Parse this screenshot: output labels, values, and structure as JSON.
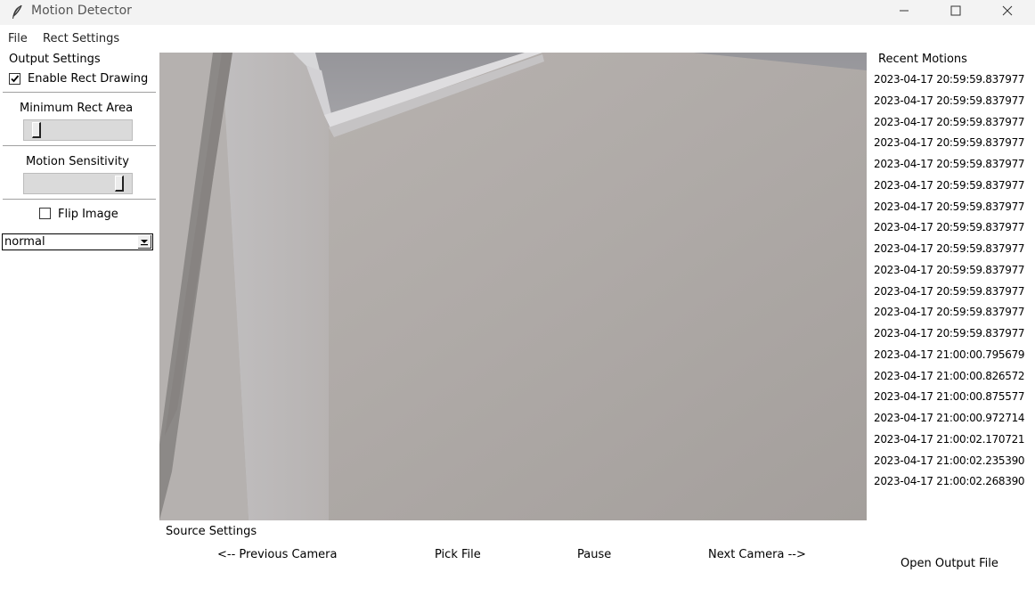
{
  "window": {
    "title": "Motion Detector",
    "app_icon": "feather-icon",
    "controls": [
      "minimize-icon",
      "maximize-icon",
      "close-icon"
    ]
  },
  "menu": {
    "file": "File",
    "rect_settings": "Rect Settings"
  },
  "output_settings": {
    "title": "Output Settings",
    "enable_rect_drawing": {
      "label": "Enable Rect Drawing",
      "checked": true
    },
    "minimum_rect_area": {
      "label": "Minimum Rect Area",
      "level": 0.08
    },
    "motion_sensitivity": {
      "label": "Motion Sensitivity",
      "level": 0.92
    },
    "flip_image": {
      "label": "Flip Image",
      "checked": false
    },
    "mode": {
      "value": "normal"
    }
  },
  "recent_motions": {
    "title": "Recent Motions",
    "items": [
      "2023-04-17 20:59:59.837977",
      "2023-04-17 20:59:59.837977",
      "2023-04-17 20:59:59.837977",
      "2023-04-17 20:59:59.837977",
      "2023-04-17 20:59:59.837977",
      "2023-04-17 20:59:59.837977",
      "2023-04-17 20:59:59.837977",
      "2023-04-17 20:59:59.837977",
      "2023-04-17 20:59:59.837977",
      "2023-04-17 20:59:59.837977",
      "2023-04-17 20:59:59.837977",
      "2023-04-17 20:59:59.837977",
      "2023-04-17 20:59:59.837977",
      "2023-04-17 21:00:00.795679",
      "2023-04-17 21:00:00.826572",
      "2023-04-17 21:00:00.875577",
      "2023-04-17 21:00:00.972714",
      "2023-04-17 21:00:02.170721",
      "2023-04-17 21:00:02.235390",
      "2023-04-17 21:00:02.268390"
    ]
  },
  "source_settings": {
    "title": "Source Settings",
    "previous_camera": "<-- Previous Camera",
    "pick_file": "Pick File",
    "pause": "Pause",
    "next_camera": "Next Camera -->"
  },
  "open_output_file": "Open Output File"
}
